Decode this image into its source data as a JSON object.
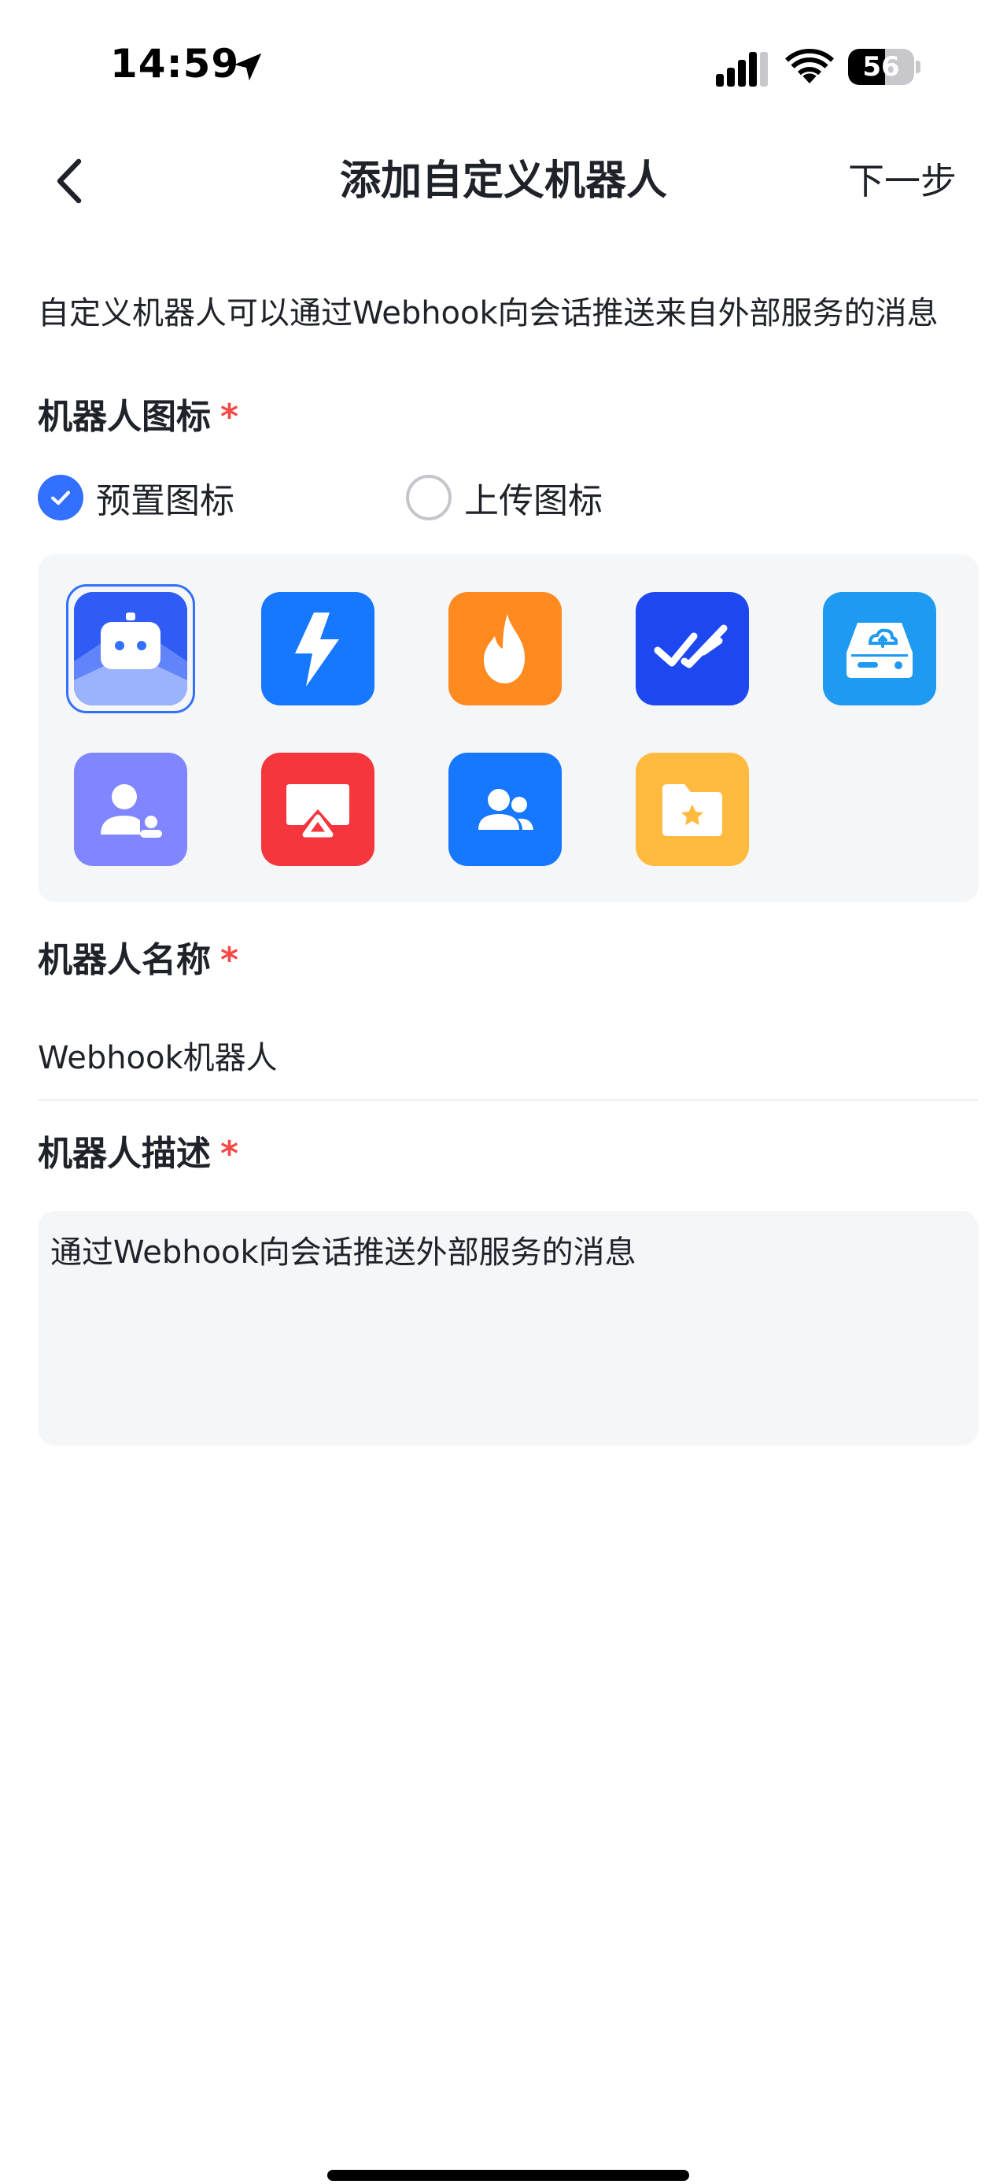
{
  "status_bar": {
    "time": "14:59",
    "battery_level": "56",
    "battery_percent": 56,
    "icons": [
      "location-arrow-icon",
      "cellular-signal-icon",
      "wifi-icon",
      "battery-icon"
    ]
  },
  "nav": {
    "back_icon": "chevron-left-icon",
    "title": "添加自定义机器人",
    "next_label": "下一步"
  },
  "intro_text": "自定义机器人可以通过Webhook向会话推送来自外部服务的消息",
  "icon_section": {
    "label": "机器人图标",
    "required_mark": "*",
    "options": [
      {
        "label": "预置图标",
        "selected": true
      },
      {
        "label": "上传图标",
        "selected": false
      }
    ],
    "icons": [
      {
        "name": "robot-icon",
        "color": "#3370ff",
        "selected": true
      },
      {
        "name": "lightning-icon",
        "color": "#1677ff",
        "selected": false
      },
      {
        "name": "flame-icon",
        "color": "#ff8a1f",
        "selected": false
      },
      {
        "name": "double-check-icon",
        "color": "#1d48f0",
        "selected": false
      },
      {
        "name": "cloud-server-icon",
        "color": "#1e9bf0",
        "selected": false
      },
      {
        "name": "user-card-icon",
        "color": "#7f86ff",
        "selected": false
      },
      {
        "name": "screen-cast-icon",
        "color": "#f5363d",
        "selected": false
      },
      {
        "name": "group-users-icon",
        "color": "#1677ff",
        "selected": false
      },
      {
        "name": "star-folder-icon",
        "color": "#ffba3f",
        "selected": false
      }
    ]
  },
  "name_section": {
    "label": "机器人名称",
    "required_mark": "*",
    "value": "Webhook机器人"
  },
  "desc_section": {
    "label": "机器人描述",
    "required_mark": "*",
    "value": "通过Webhook向会话推送外部服务的消息"
  },
  "colors": {
    "accent": "#3370ff",
    "required": "#f54a45",
    "panel_bg": "#f5f6f8"
  }
}
